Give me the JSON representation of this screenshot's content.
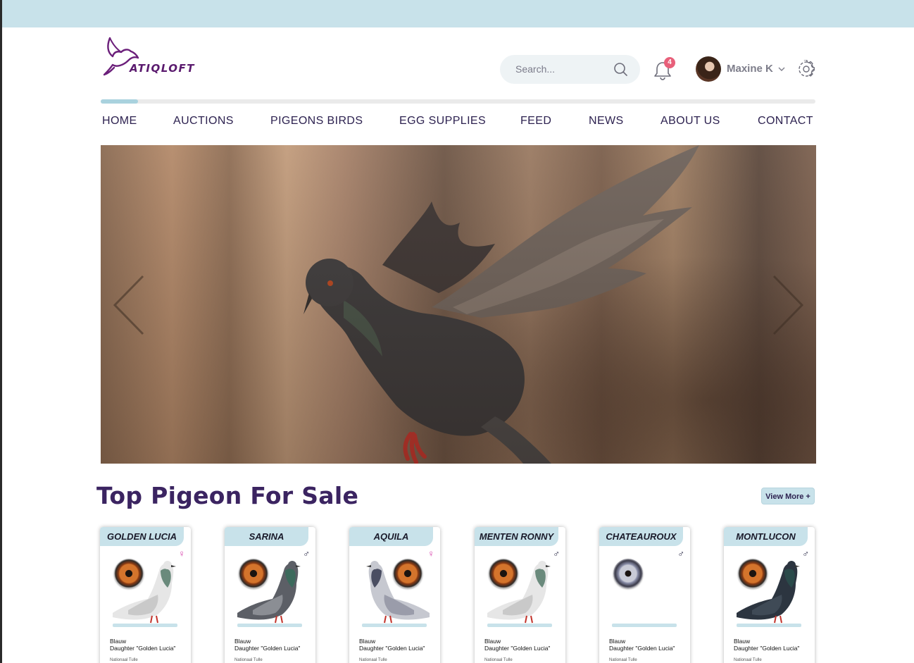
{
  "brand": {
    "name": "ATIQLOFT"
  },
  "search": {
    "placeholder": "Search..."
  },
  "notifications": {
    "count": "4"
  },
  "user": {
    "name": "Maxine K"
  },
  "nav": {
    "items": [
      "HOME",
      "AUCTIONS",
      "PIGEONS BIRDS",
      "EGG SUPPLIES",
      "FEED",
      "NEWS",
      "ABOUT US",
      "CONTACT"
    ]
  },
  "section": {
    "title": "Top Pigeon For Sale",
    "view_more": "View More +"
  },
  "cards": [
    {
      "name": "GOLDEN LUCIA",
      "sex": "♀",
      "color": "Blauw",
      "pedigree": "Daughter \"Golden Lucia\"",
      "note": "Nationaal Tulle"
    },
    {
      "name": "SARINA",
      "sex": "♂",
      "color": "Blauw",
      "pedigree": "Daughter \"Golden Lucia\"",
      "note": "Nationaal Tulle"
    },
    {
      "name": "AQUILA",
      "sex": "♀",
      "color": "Blauw",
      "pedigree": "Daughter \"Golden Lucia\"",
      "note": "Nationaal Tulle"
    },
    {
      "name": "MENTEN RONNY",
      "sex": "♂",
      "color": "Blauw",
      "pedigree": "Daughter \"Golden Lucia\"",
      "note": "Nationaal Tulle"
    },
    {
      "name": "CHATEAUROUX",
      "sex": "♂",
      "color": "Blauw",
      "pedigree": "Daughter \"Golden Lucia\"",
      "note": "Nationaal Tulle"
    },
    {
      "name": "MONTLUCON",
      "sex": "♂",
      "color": "Blauw",
      "pedigree": "Daughter \"Golden Lucia\"",
      "note": "Nationaal Tulle"
    }
  ],
  "colors": {
    "accent": "#c8e2ea",
    "brand": "#5a1a6e",
    "heading": "#3b2461",
    "badge": "#e8607a",
    "female": "#d63aa8",
    "male": "#1a1a3a"
  },
  "icons": [
    "search-icon",
    "bell-icon",
    "chevron-down-icon",
    "gear-icon",
    "chevron-left-icon",
    "chevron-right-icon"
  ]
}
